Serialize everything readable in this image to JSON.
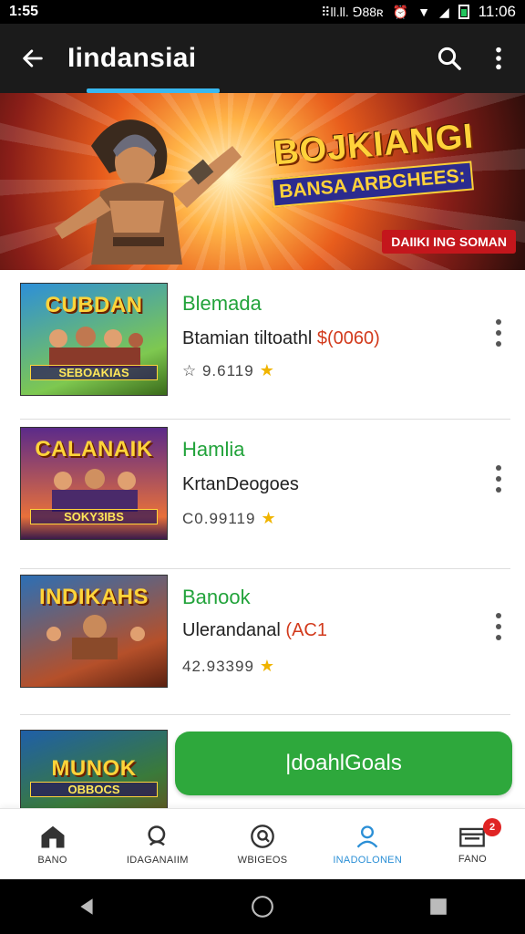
{
  "status_bar": {
    "time": "1:55",
    "net": "⠿ll.ll. ⅁88ʀ",
    "clock": "11:06"
  },
  "app_bar": {
    "title": "Iindansiai"
  },
  "banner": {
    "headline": "BOJKIANGI",
    "subline": "BANSA ARBGHEES:",
    "tag": "DAIIKI ING SOMAN"
  },
  "games": [
    {
      "title": "Blemada",
      "subtitle": "Btamian tiltoathl ",
      "subtitle_accent": "$(0060)",
      "rating": "☆ 9.6119",
      "thumb_title": "CUBDAN",
      "thumb_sub": "SEBOAKIAS",
      "thumb_colors": [
        "#2d8fd8",
        "#7ec850"
      ]
    },
    {
      "title": "Hamlia",
      "subtitle": "KrtanDeogoes",
      "subtitle_accent": "",
      "rating": "C0.99119",
      "thumb_title": "CALANAIK",
      "thumb_sub": "SOKY3IBS",
      "thumb_colors": [
        "#5b2a8a",
        "#e8703a"
      ]
    },
    {
      "title": "Banook",
      "subtitle": "Ulerandanal ",
      "subtitle_accent": "(AC1",
      "rating": "42.93399",
      "thumb_title": "INDIKAHS",
      "thumb_sub": "",
      "thumb_colors": [
        "#2c6fb5",
        "#b5502a"
      ]
    },
    {
      "title": "",
      "subtitle": "",
      "subtitle_accent": "",
      "rating": "",
      "thumb_title": "MUNOK",
      "thumb_sub": "OBBOCS",
      "thumb_colors": [
        "#3a7a3a",
        "#1f5fa8"
      ]
    }
  ],
  "cta": {
    "label": "|doahlGoals"
  },
  "bottom_nav": [
    {
      "label": "BANO",
      "icon": "home-icon"
    },
    {
      "label": "IDAGANAIIM",
      "icon": "search-icon"
    },
    {
      "label": "WBIGEOS",
      "icon": "search-circle-icon"
    },
    {
      "label": "INADOLONEN",
      "icon": "profile-icon",
      "active": true
    },
    {
      "label": "FANO",
      "icon": "inbox-icon",
      "badge": "2"
    }
  ],
  "colors": {
    "accent_green": "#2ea83c",
    "accent_blue": "#39b8f0",
    "app_bar": "#1b1b1b"
  }
}
